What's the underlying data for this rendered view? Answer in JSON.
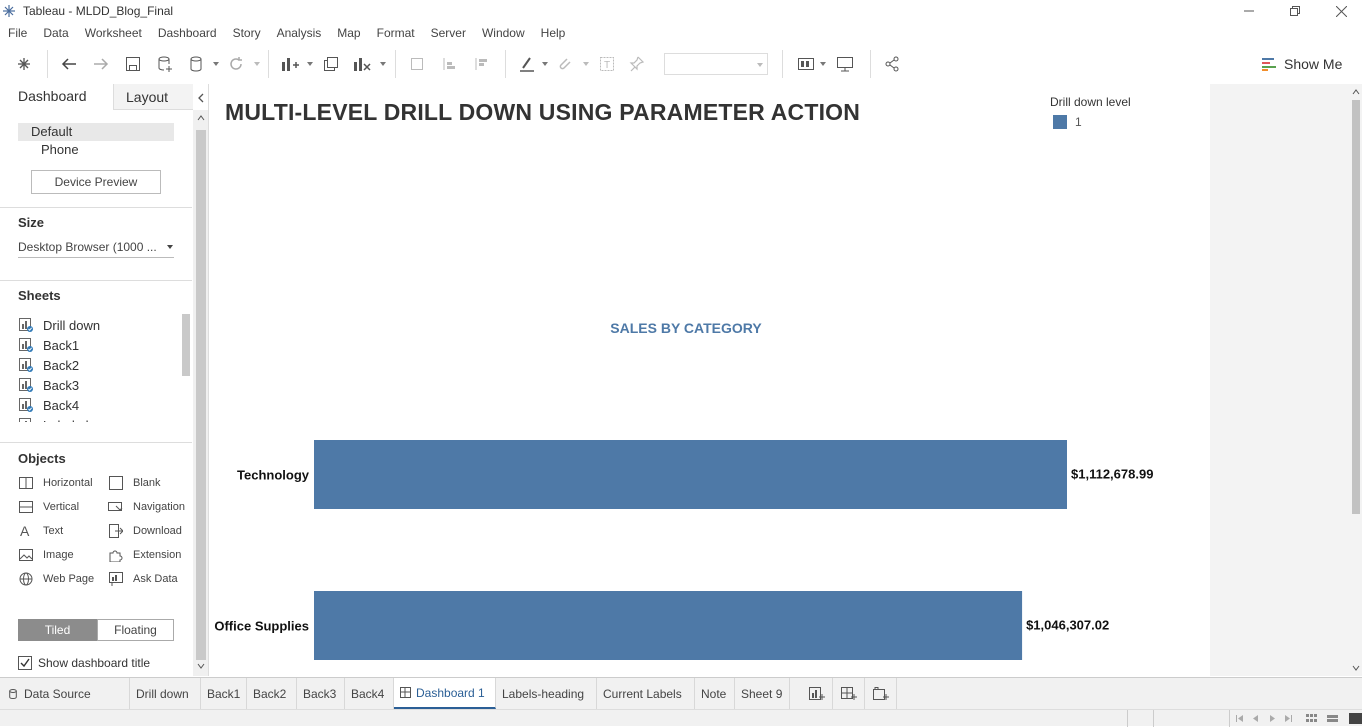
{
  "window": {
    "title": "Tableau - MLDD_Blog_Final"
  },
  "menu": [
    "File",
    "Data",
    "Worksheet",
    "Dashboard",
    "Story",
    "Analysis",
    "Map",
    "Format",
    "Server",
    "Window",
    "Help"
  ],
  "toolbar": {
    "show_me": "Show Me"
  },
  "left_panel": {
    "tabs": {
      "dashboard": "Dashboard",
      "layout": "Layout"
    },
    "device": {
      "default": "Default",
      "phone": "Phone",
      "preview_button": "Device Preview"
    },
    "size": {
      "heading": "Size",
      "value": "Desktop Browser (1000 ..."
    },
    "sheets": {
      "heading": "Sheets",
      "items": [
        "Drill down",
        "Back1",
        "Back2",
        "Back3",
        "Back4",
        "Labels-hea"
      ]
    },
    "objects": {
      "heading": "Objects",
      "items": [
        {
          "label": "Horizontal",
          "icon": "horizontal-icon"
        },
        {
          "label": "Blank",
          "icon": "blank-icon"
        },
        {
          "label": "Vertical",
          "icon": "vertical-icon"
        },
        {
          "label": "Navigation",
          "icon": "navigation-icon"
        },
        {
          "label": "Text",
          "icon": "text-icon"
        },
        {
          "label": "Download",
          "icon": "download-icon"
        },
        {
          "label": "Image",
          "icon": "image-icon"
        },
        {
          "label": "Extension",
          "icon": "extension-icon"
        },
        {
          "label": "Web Page",
          "icon": "web-page-icon"
        },
        {
          "label": "Ask Data",
          "icon": "ask-data-icon"
        }
      ]
    },
    "layout_mode": {
      "tiled": "Tiled",
      "floating": "Floating"
    },
    "show_title": "Show dashboard title"
  },
  "dashboard": {
    "title": "MULTI-LEVEL DRILL DOWN USING PARAMETER ACTION",
    "legend": {
      "title": "Drill down level",
      "items": [
        {
          "label": "1",
          "color": "#4e79a7"
        }
      ]
    }
  },
  "chart_data": {
    "type": "bar",
    "title": "SALES BY CATEGORY",
    "orientation": "horizontal",
    "categories": [
      "Technology",
      "Office Supplies"
    ],
    "values": [
      1112678.99,
      1046307.02
    ],
    "value_labels": [
      "$1,112,678.99",
      "$1,046,307.02"
    ],
    "color": "#4e79a7",
    "xlim": [
      0,
      1112678.99
    ]
  },
  "tabs": {
    "data_source": "Data Source",
    "sheets": [
      "Drill down",
      "Back1",
      "Back2",
      "Back3",
      "Back4",
      "Dashboard 1",
      "Labels-heading",
      "Current Labels",
      "Note",
      "Sheet 9"
    ],
    "active": "Dashboard 1"
  },
  "colors": {
    "accent": "#4e79a7",
    "title_blue": "#4e79a7"
  }
}
